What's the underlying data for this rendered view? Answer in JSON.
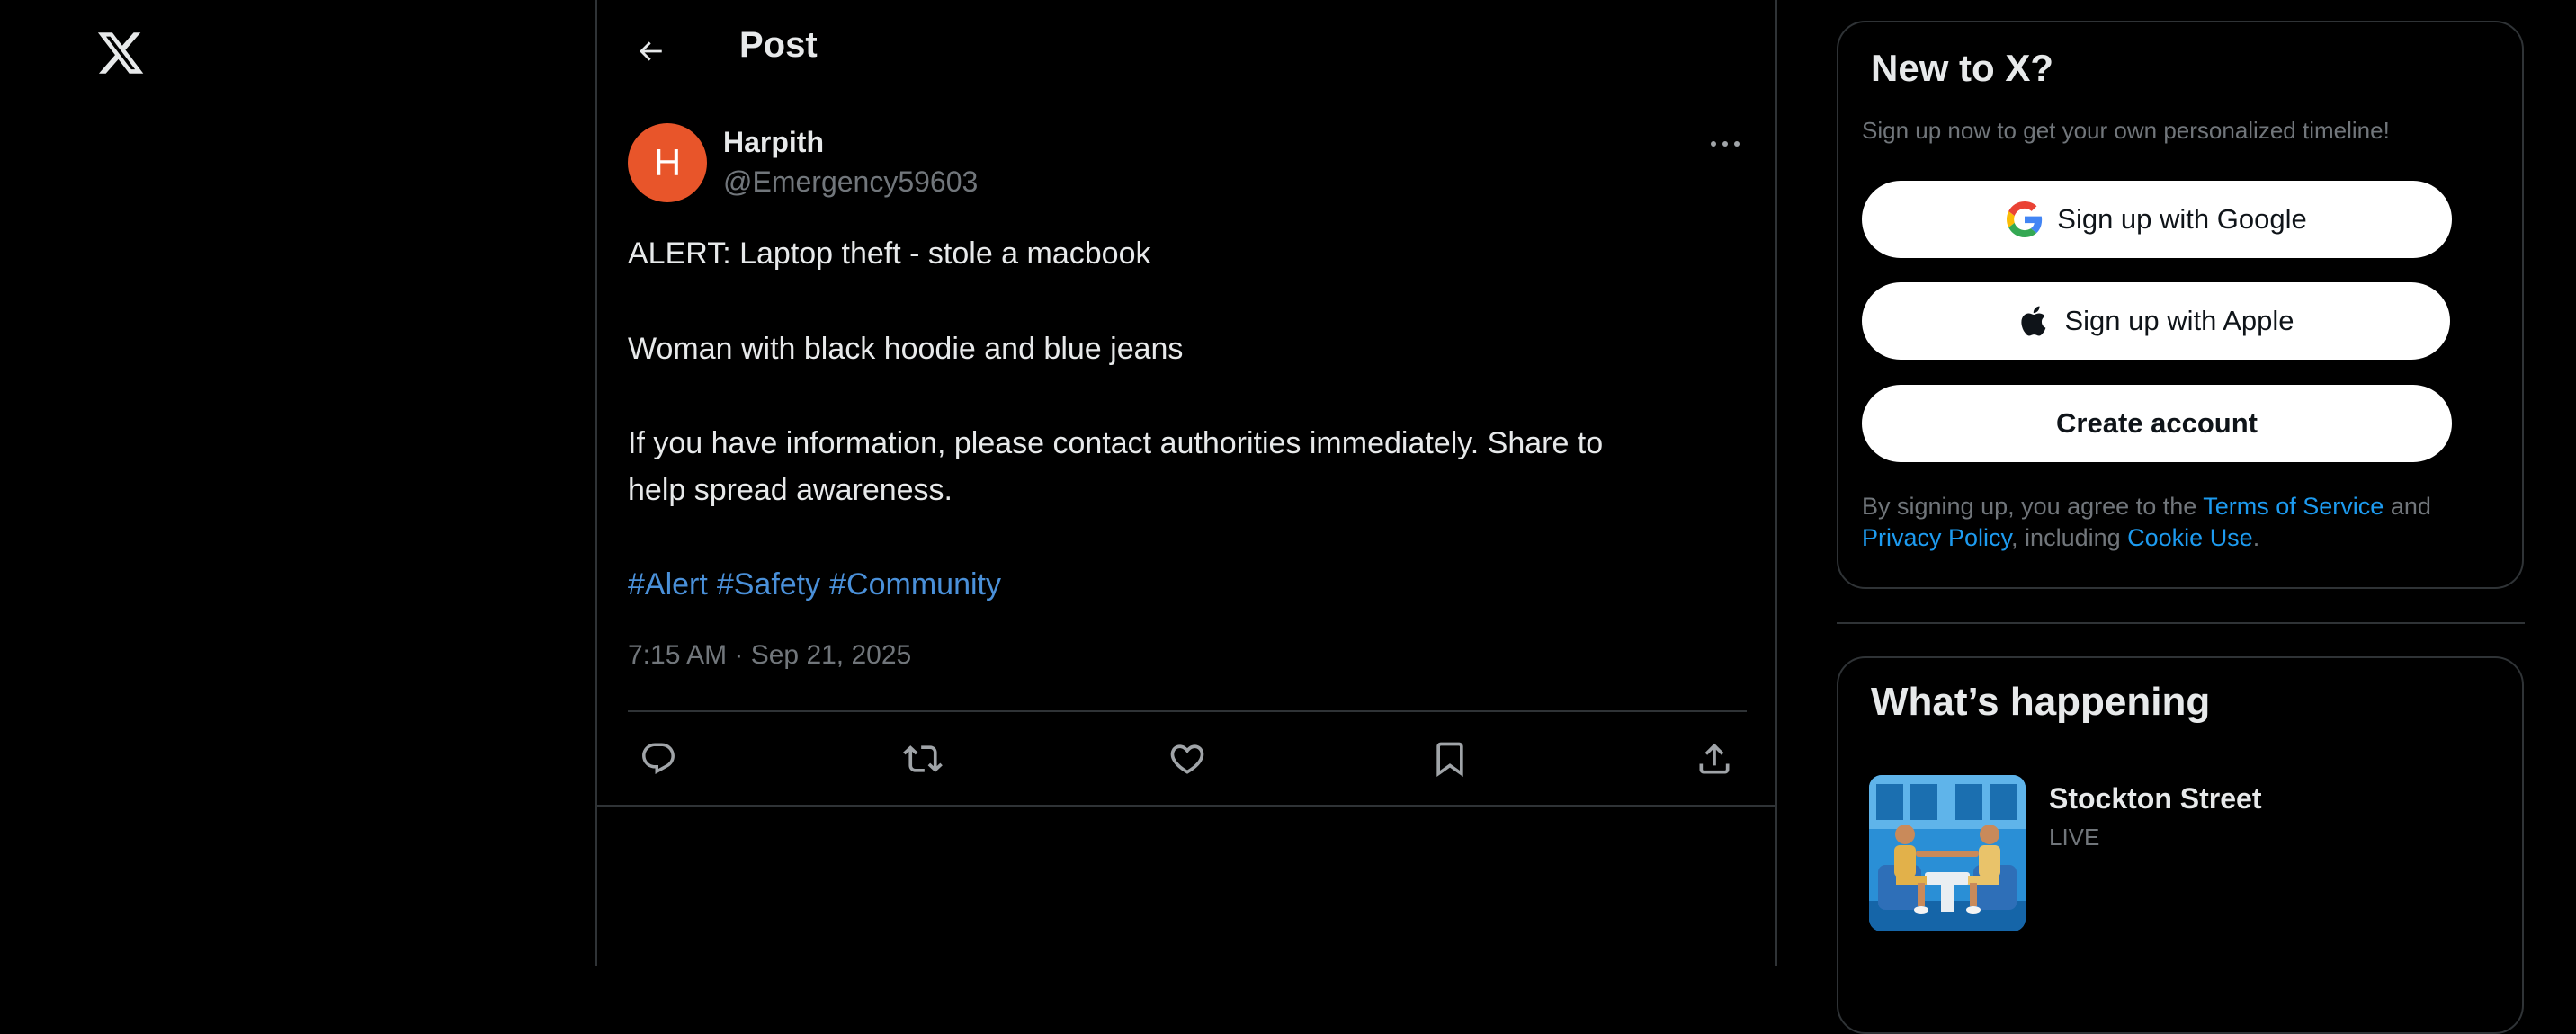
{
  "nav": {
    "logo_icon": "x-logo-icon"
  },
  "header": {
    "title": "Post",
    "back_icon": "arrow-left-icon"
  },
  "post": {
    "author": {
      "avatar_initial": "H",
      "avatar_color": "#e8552a",
      "name": "Harpith",
      "handle": "@Emergency59603"
    },
    "more_icon": "more-dots-icon",
    "lines": [
      "ALERT: Laptop theft - stole a macbook",
      "Woman with black hoodie and blue jeans",
      "If you have information, please contact authorities immediately. Share to",
      "help spread awareness."
    ],
    "hashtags": [
      "#Alert",
      "#Safety",
      "#Community"
    ],
    "timestamp": "7:15 AM · Sep 21, 2025",
    "actions": [
      "reply-icon",
      "repost-icon",
      "like-icon",
      "bookmark-icon",
      "share-icon"
    ]
  },
  "signup": {
    "title": "New to X?",
    "subtitle": "Sign up now to get your own personalized timeline!",
    "google_label": "Sign up with Google",
    "apple_label": "Sign up with Apple",
    "create_label": "Create account",
    "legal": {
      "prefix": "By signing up, you agree to the ",
      "terms": "Terms of Service",
      "and": " and",
      "privacy": "Privacy Policy",
      "including": ", including ",
      "cookie": "Cookie Use",
      "end": "."
    }
  },
  "trends": {
    "title": "What’s happening",
    "items": [
      {
        "name": "Stockton Street",
        "status": "LIVE"
      }
    ]
  },
  "colors": {
    "background": "#000000",
    "text": "#e7e9ea",
    "muted": "#71767b",
    "hashtag": "#4a90d9",
    "link": "#1d9bf0",
    "border": "#2f3336"
  }
}
